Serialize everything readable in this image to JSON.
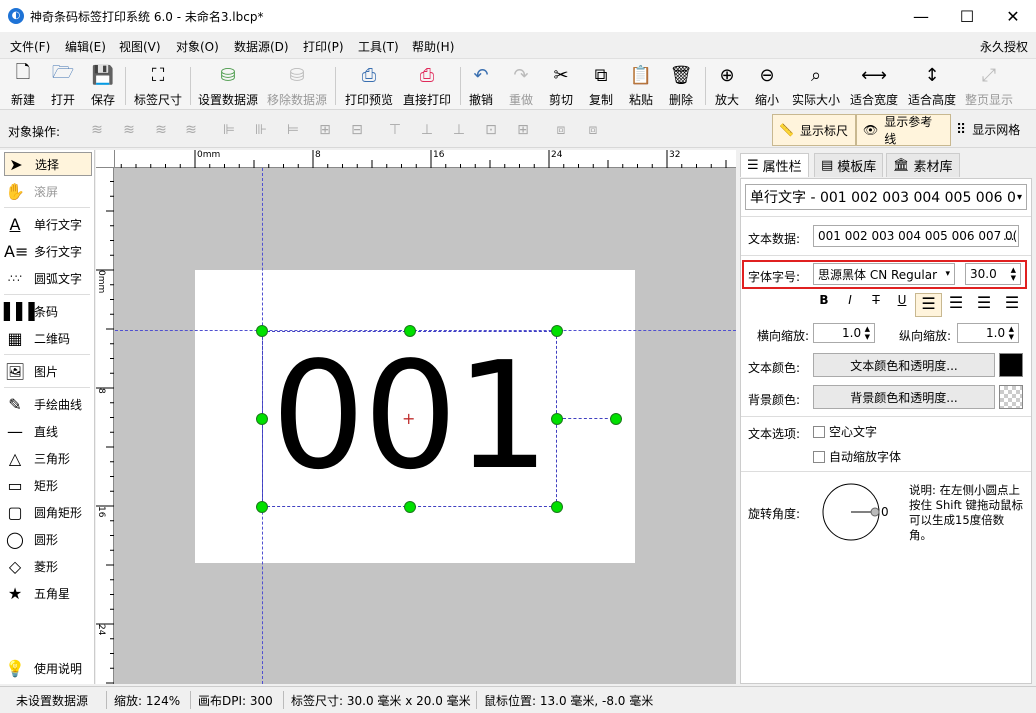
{
  "window": {
    "title": "神奇条码标签打印系统 6.0 - 未命名3.lbcp*",
    "app_icon": "app-logo"
  },
  "menu": {
    "items": [
      "文件(F)",
      "编辑(E)",
      "视图(V)",
      "对象(O)",
      "数据源(D)",
      "打印(P)",
      "工具(T)",
      "帮助(H)"
    ],
    "license": "永久授权"
  },
  "toolbar": {
    "items": [
      {
        "label": "新建",
        "icon": "new-file-icon"
      },
      {
        "label": "打开",
        "icon": "open-icon"
      },
      {
        "label": "保存",
        "icon": "save-icon"
      },
      {
        "label": "标签尺寸",
        "icon": "label-size-icon"
      },
      {
        "label": "设置数据源",
        "icon": "database-icon"
      },
      {
        "label": "移除数据源",
        "icon": "remove-database-icon",
        "disabled": true
      },
      {
        "label": "打印预览",
        "icon": "print-preview-icon"
      },
      {
        "label": "直接打印",
        "icon": "print-icon"
      },
      {
        "label": "撤销",
        "icon": "undo-icon"
      },
      {
        "label": "重做",
        "icon": "redo-icon",
        "disabled": true
      },
      {
        "label": "剪切",
        "icon": "cut-icon"
      },
      {
        "label": "复制",
        "icon": "copy-icon"
      },
      {
        "label": "粘贴",
        "icon": "paste-icon"
      },
      {
        "label": "删除",
        "icon": "delete-icon"
      },
      {
        "label": "放大",
        "icon": "zoom-in-icon"
      },
      {
        "label": "缩小",
        "icon": "zoom-out-icon"
      },
      {
        "label": "实际大小",
        "icon": "actual-size-icon"
      },
      {
        "label": "适合宽度",
        "icon": "fit-width-icon"
      },
      {
        "label": "适合高度",
        "icon": "fit-height-icon"
      },
      {
        "label": "整页显示",
        "icon": "full-page-icon",
        "disabled": true
      }
    ]
  },
  "objbar": {
    "label": "对象操作:",
    "show_ruler": "显示标尺",
    "show_guides": "显示参考线",
    "show_grid": "显示网格"
  },
  "tools": {
    "items": [
      {
        "label": "选择",
        "icon": "arrow-cursor-icon",
        "selected": true
      },
      {
        "label": "滚屏",
        "icon": "hand-icon",
        "disabled": true
      },
      {
        "label": "单行文字",
        "icon": "single-line-text-icon"
      },
      {
        "label": "多行文字",
        "icon": "multi-line-text-icon"
      },
      {
        "label": "圆弧文字",
        "icon": "arc-text-icon"
      },
      {
        "label": "条码",
        "icon": "barcode-icon"
      },
      {
        "label": "二维码",
        "icon": "qrcode-icon"
      },
      {
        "label": "图片",
        "icon": "image-icon"
      },
      {
        "label": "手绘曲线",
        "icon": "pen-icon"
      },
      {
        "label": "直线",
        "icon": "line-icon"
      },
      {
        "label": "三角形",
        "icon": "triangle-icon"
      },
      {
        "label": "矩形",
        "icon": "rectangle-icon"
      },
      {
        "label": "圆角矩形",
        "icon": "rounded-rectangle-icon"
      },
      {
        "label": "圆形",
        "icon": "circle-icon"
      },
      {
        "label": "菱形",
        "icon": "diamond-icon"
      },
      {
        "label": "五角星",
        "icon": "star-icon"
      }
    ],
    "help": "使用说明"
  },
  "ruler": {
    "h_ticks": [
      "0mm",
      "8",
      "16",
      "24",
      "32"
    ],
    "v_ticks": [
      "0mm",
      "8",
      "16",
      "24"
    ]
  },
  "canvas": {
    "text": "001"
  },
  "panel": {
    "tabs": [
      "属性栏",
      "模板库",
      "素材库"
    ],
    "object_select": "单行文字 - 001 002 003 004 005 006 0",
    "text_data_label": "文本数据:",
    "text_data_value": "001 002 003 004 005 006 007 0(",
    "text_data_btn": "...",
    "font_label": "字体字号:",
    "font_name": "思源黑体 CN Regular",
    "font_size": "30.0",
    "hscale_label": "横向缩放:",
    "hscale": "1.0",
    "vscale_label": "纵向缩放:",
    "vscale": "1.0",
    "text_color_label": "文本颜色:",
    "text_color_btn": "文本颜色和透明度...",
    "text_color": "#000000",
    "bg_color_label": "背景颜色:",
    "bg_color_btn": "背景颜色和透明度...",
    "options_label": "文本选项:",
    "hollow": "空心文字",
    "autoscale": "自动缩放字体",
    "rotate_label": "旋转角度:",
    "rotate_value": "0",
    "rotate_note": "说明: 在左侧小圆点上按住 Shift 键拖动鼠标可以生成15度倍数角。"
  },
  "status": {
    "datasource": "未设置数据源",
    "zoom": "缩放: 124%",
    "dpi": "画布DPI: 300",
    "label_size": "标签尺寸: 30.0 毫米 x 20.0 毫米",
    "mouse_pos": "鼠标位置: 13.0 毫米, -8.0 毫米"
  }
}
